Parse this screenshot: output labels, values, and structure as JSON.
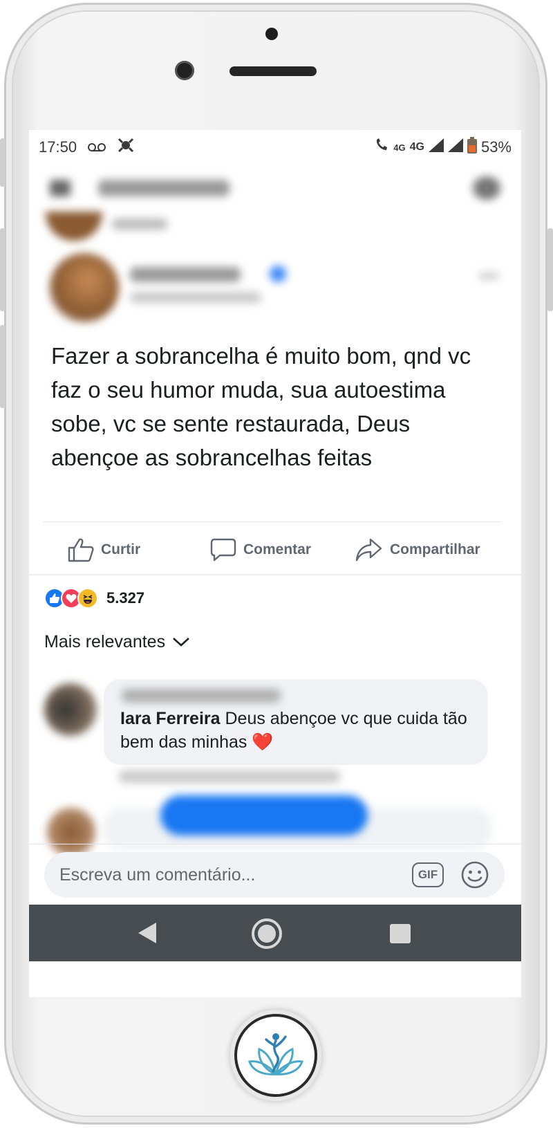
{
  "status_bar": {
    "time": "17:50",
    "voicemail_icon": "voicemail-icon",
    "app_icon": "bug-icon",
    "call_icon": "wifi-call-icon",
    "small_4g": "4G",
    "network": "4G",
    "battery_percent": "53%"
  },
  "post": {
    "text": "Fazer a sobrancelha é muito bom, qnd vc faz o seu humor muda, sua autoestima sobe, vc se sente restaurada, Deus abençoe as sobrancelhas feitas"
  },
  "actions": {
    "like_label": "Curtir",
    "comment_label": "Comentar",
    "share_label": "Compartilhar"
  },
  "reactions": {
    "count": "5.327",
    "types": [
      "like",
      "love",
      "haha"
    ]
  },
  "comments": {
    "sort_label": "Mais relevantes",
    "items": [
      {
        "author": "Iara Ferreira",
        "text": "Deus abençoe vc que cuida tão bem das minhas ❤️"
      }
    ]
  },
  "composer": {
    "placeholder": "Escreva um comentário...",
    "gif_label": "GIF"
  },
  "colors": {
    "accent": "#1877f2",
    "love": "#f33e58",
    "haha": "#f7b928",
    "navbar": "#474c51",
    "bubble": "#f0f2f5"
  }
}
